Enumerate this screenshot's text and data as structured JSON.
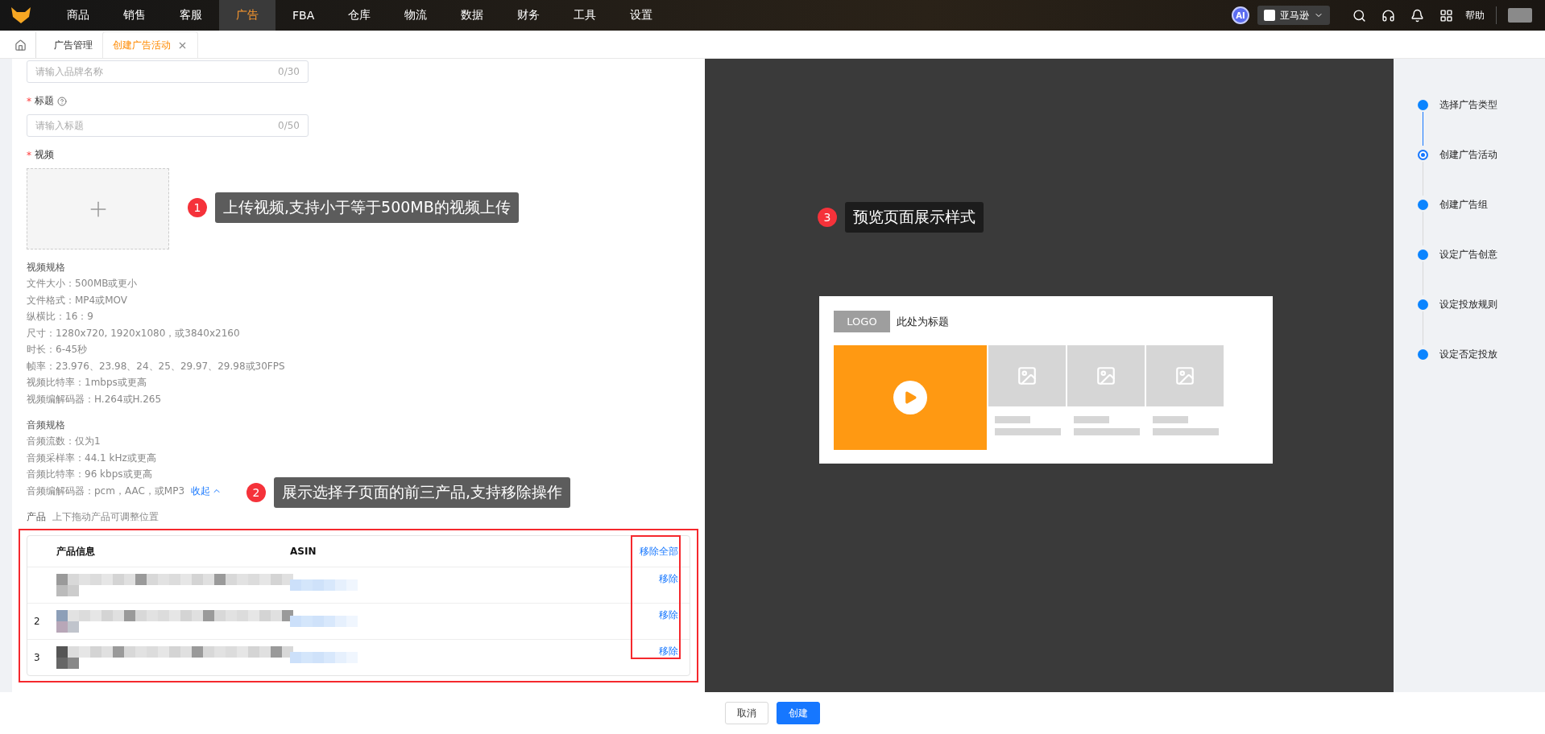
{
  "nav": {
    "items": [
      {
        "label": "商品",
        "selected": false
      },
      {
        "label": "销售",
        "selected": false
      },
      {
        "label": "客服",
        "selected": false
      },
      {
        "label": "广告",
        "selected": true
      },
      {
        "label": "FBA",
        "selected": false
      },
      {
        "label": "仓库",
        "selected": false
      },
      {
        "label": "物流",
        "selected": false
      },
      {
        "label": "数据",
        "selected": false
      },
      {
        "label": "财务",
        "selected": false
      },
      {
        "label": "工具",
        "selected": false
      },
      {
        "label": "设置",
        "selected": false
      }
    ],
    "ai_badge": "AI",
    "marketplace": "亚马逊",
    "help": "帮助"
  },
  "tabs": [
    {
      "label": "广告管理",
      "selected": false,
      "closable": false
    },
    {
      "label": "创建广告活动",
      "selected": true,
      "closable": true
    }
  ],
  "form": {
    "brand_field": {
      "placeholder": "请输入品牌名称",
      "count": "0/30"
    },
    "title_field": {
      "required_mark": "*",
      "label": "标题",
      "placeholder": "请输入标题",
      "count": "0/50"
    },
    "video": {
      "required_mark": "*",
      "label": "视频"
    },
    "video_specs": {
      "heading": "视频规格",
      "lines": [
        "文件大小：500MB或更小",
        "文件格式：MP4或MOV",
        "纵横比：16：9",
        "尺寸：1280x720, 1920x1080，或3840x2160",
        "时长：6-45秒",
        "帧率：23.976、23.98、24、25、29.97、29.98或30FPS",
        "视频比特率：1mbps或更高",
        "视频编解码器：H.264或H.265"
      ]
    },
    "audio_specs": {
      "heading": "音频规格",
      "lines": [
        "音频流数：仅为1",
        "音频采样率：44.1 kHz或更高",
        "音频比特率：96 kbps或更高",
        "音频编解码器：pcm，AAC，或MP3"
      ],
      "collapse_link": "收起"
    },
    "products": {
      "label": "产品",
      "hint": "上下拖动产品可调整位置",
      "columns": [
        "产品信息",
        "ASIN"
      ],
      "remove_all": "移除全部",
      "rows": [
        {
          "remove": "移除"
        },
        {
          "index": "2",
          "remove": "移除"
        },
        {
          "index": "3",
          "remove": "移除"
        }
      ]
    }
  },
  "callouts": [
    {
      "number": "1",
      "text": "上传视频,支持小于等于500MB的视频上传"
    },
    {
      "number": "2",
      "text": "展示选择子页面的前三产品,支持移除操作"
    },
    {
      "number": "3",
      "text": "预览页面展示样式"
    }
  ],
  "preview": {
    "logo": "LOGO",
    "title": "此处为标题"
  },
  "steps": [
    {
      "label": "选择广告类型",
      "current": false
    },
    {
      "label": "创建广告活动",
      "current": true
    },
    {
      "label": "创建广告组",
      "current": false
    },
    {
      "label": "设定广告创意",
      "current": false
    },
    {
      "label": "设定投放规则",
      "current": false
    },
    {
      "label": "设定否定投放",
      "current": false
    }
  ],
  "footer": {
    "buttons": [
      {
        "label": "取消",
        "kind": "secondary"
      },
      {
        "label": "创建",
        "kind": "primary"
      }
    ]
  }
}
